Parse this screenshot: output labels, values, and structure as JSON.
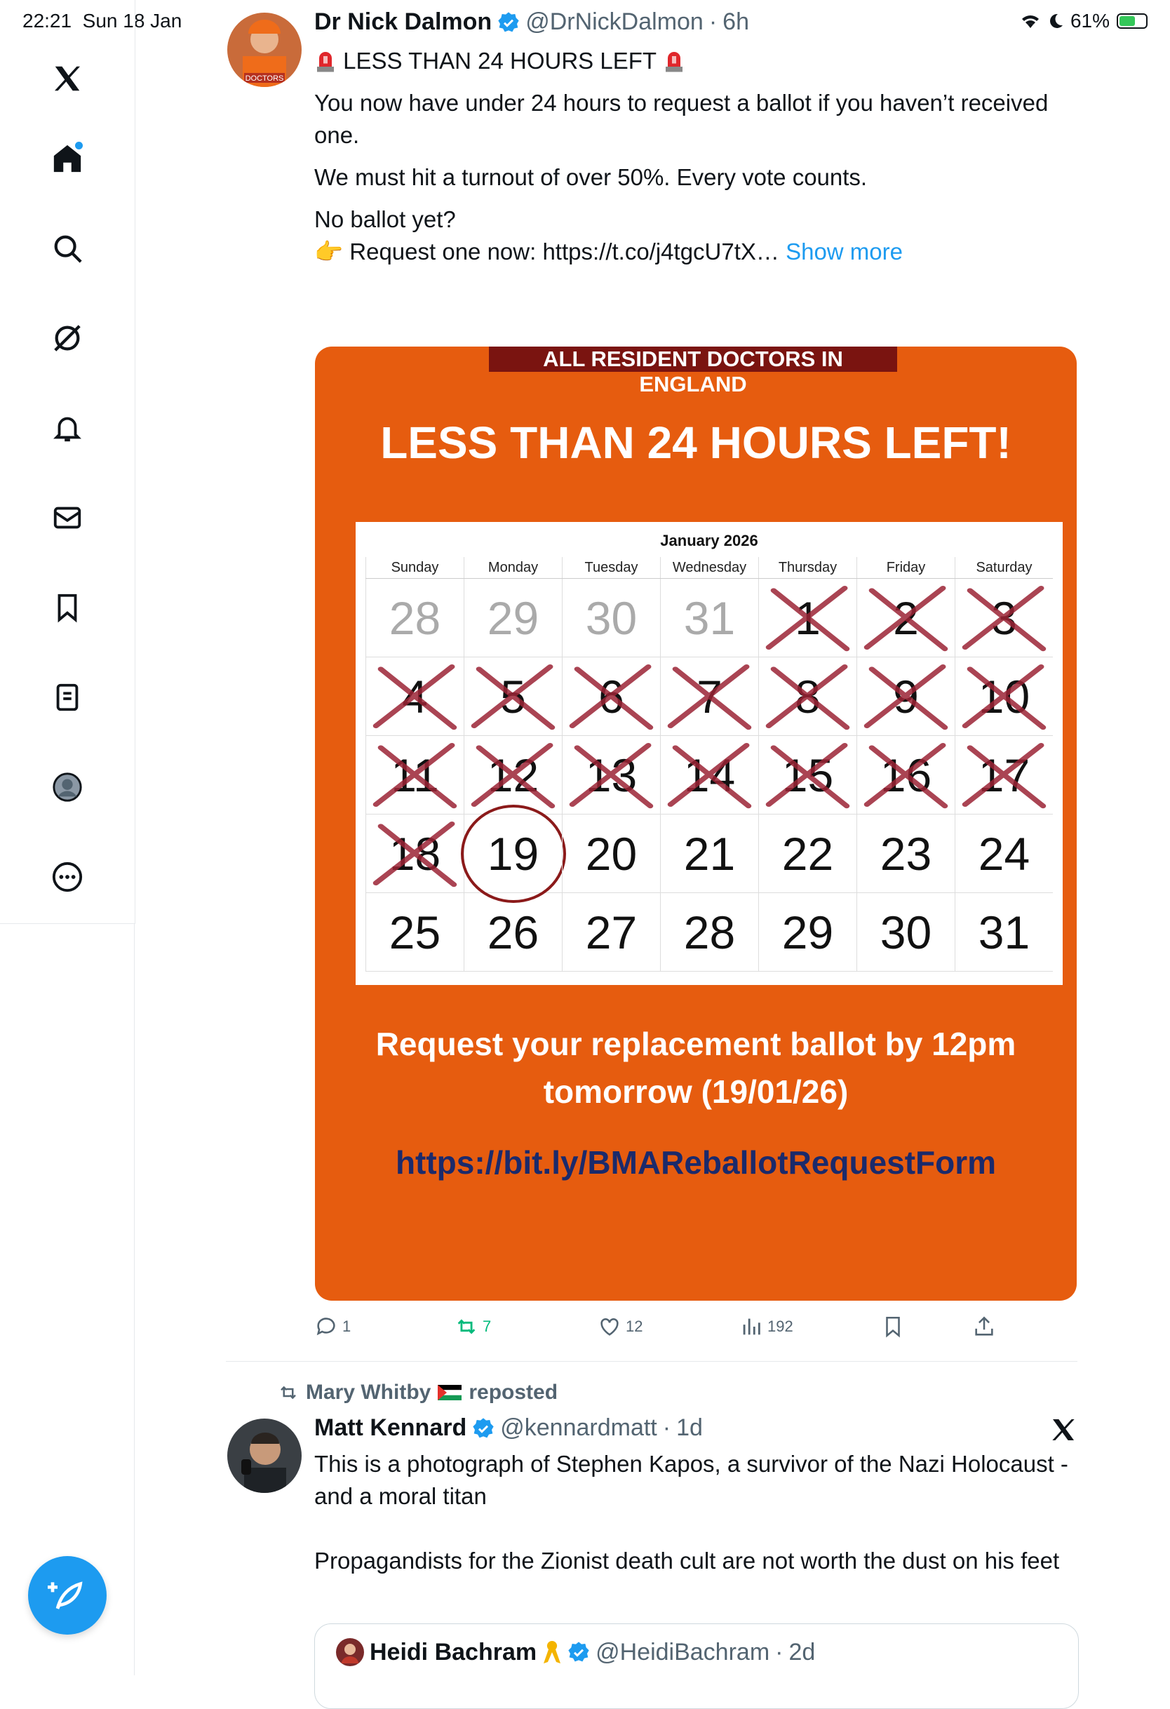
{
  "status_bar": {
    "time": "22:21",
    "date": "Sun 18 Jan",
    "battery": "61%",
    "battery_level": 0.61
  },
  "sidebar": {
    "items": [
      {
        "name": "x-logo"
      },
      {
        "name": "home"
      },
      {
        "name": "explore"
      },
      {
        "name": "grok"
      },
      {
        "name": "notifications"
      },
      {
        "name": "messages"
      },
      {
        "name": "bookmarks"
      },
      {
        "name": "lists"
      },
      {
        "name": "profile"
      },
      {
        "name": "more"
      }
    ]
  },
  "tweet1": {
    "author_name": "Dr Nick Dalmon",
    "handle": "@DrNickDalmon",
    "time": "6h",
    "avatar_badge": "DOCTORS",
    "line1": "LESS THAN 24 HOURS LEFT",
    "para1": "You now have under 24 hours to request a ballot if you haven’t received one.",
    "para2": "We must hit a turnout of over 50%. Every vote counts.",
    "para3": "No ballot yet?",
    "para4_prefix": "👉 Request one now: https://t.co/j4tgcU7tX…",
    "show_more": "Show more",
    "poster": {
      "banner": "ALL RESIDENT DOCTORS IN ENGLAND",
      "title": "LESS THAN 24 HOURS LEFT!",
      "calendar_month": "January 2026",
      "weekdays": [
        "Sunday",
        "Monday",
        "Tuesday",
        "Wednesday",
        "Thursday",
        "Friday",
        "Saturday"
      ],
      "days": [
        {
          "n": "28",
          "prev": true
        },
        {
          "n": "29",
          "prev": true
        },
        {
          "n": "30",
          "prev": true
        },
        {
          "n": "31",
          "prev": true
        },
        {
          "n": "1",
          "x": true
        },
        {
          "n": "2",
          "x": true
        },
        {
          "n": "3",
          "x": true
        },
        {
          "n": "4",
          "x": true
        },
        {
          "n": "5",
          "x": true
        },
        {
          "n": "6",
          "x": true
        },
        {
          "n": "7",
          "x": true
        },
        {
          "n": "8",
          "x": true
        },
        {
          "n": "9",
          "x": true
        },
        {
          "n": "10",
          "x": true
        },
        {
          "n": "11",
          "x": true
        },
        {
          "n": "12",
          "x": true
        },
        {
          "n": "13",
          "x": true
        },
        {
          "n": "14",
          "x": true
        },
        {
          "n": "15",
          "x": true
        },
        {
          "n": "16",
          "x": true
        },
        {
          "n": "17",
          "x": true
        },
        {
          "n": "18",
          "x": true
        },
        {
          "n": "19",
          "circled": true
        },
        {
          "n": "20"
        },
        {
          "n": "21"
        },
        {
          "n": "22"
        },
        {
          "n": "23"
        },
        {
          "n": "24"
        },
        {
          "n": "25"
        },
        {
          "n": "26"
        },
        {
          "n": "27"
        },
        {
          "n": "28"
        },
        {
          "n": "29"
        },
        {
          "n": "30"
        },
        {
          "n": "31"
        }
      ],
      "request_line1": "Request your replacement ballot by 12pm",
      "request_line2": "tomorrow (19/01/26)",
      "url": "https://bit.ly/BMAReballotRequestForm"
    },
    "actions": {
      "replies": "1",
      "reposts": "7",
      "likes": "12",
      "views": "192"
    }
  },
  "tweet2": {
    "reposted_by": "Mary Whitby",
    "reposted_label": "reposted",
    "author_name": "Matt Kennard",
    "handle": "@kennardmatt",
    "time": "1d",
    "para1": "This is a photograph of Stephen Kapos, a survivor of the Nazi Holocaust - and a moral titan",
    "para2": "Propagandists for the Zionist death cult are not worth the dust on his feet",
    "quote": {
      "author_name": "Heidi Bachram",
      "handle": "@HeidiBachram",
      "time": "2d"
    }
  },
  "colors": {
    "accent": "#1d9bf0",
    "poster_orange": "#e65c0f",
    "banner_red": "#7a1410",
    "url_blue": "#1b2a6b",
    "repost_green": "#00ba7c",
    "cross": "#9b2335"
  }
}
